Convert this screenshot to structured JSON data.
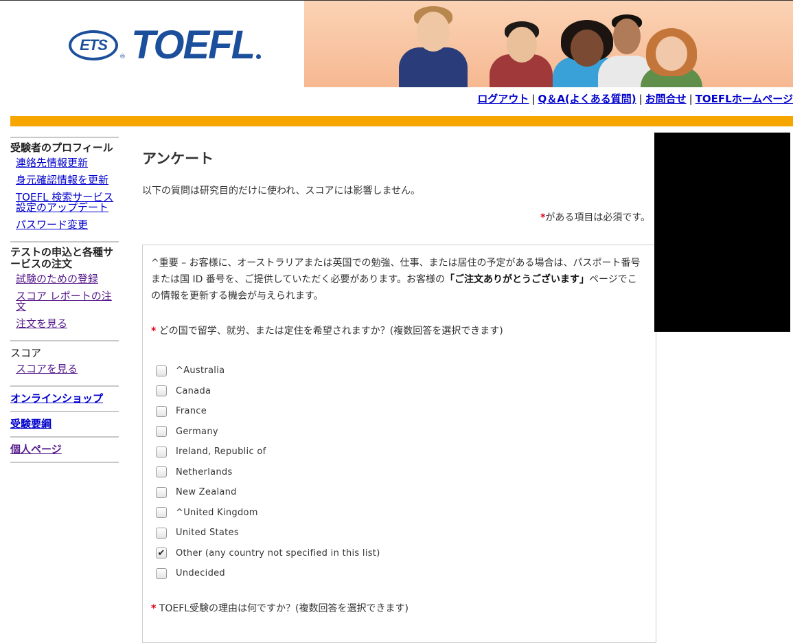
{
  "header": {
    "logo_ets": "ETS",
    "logo_reg": "®",
    "logo_toefl": "TOEFL",
    "links": [
      "ログアウト",
      "Q＆A(よくある質問)",
      "お問合せ",
      "TOEFLホームページ"
    ]
  },
  "sidebar": {
    "groups": [
      {
        "heading": "受験者のプロフィール",
        "items": [
          "連絡先情報更新",
          "身元確認情報を更新",
          "TOEFL 検索サービス設定のアップデート",
          "パスワード変更"
        ]
      },
      {
        "heading": "テストの申込と各種サービスの注文",
        "items": [
          "試験のための登録",
          "スコア レポートの注文",
          "注文を見る"
        ]
      },
      {
        "heading": "スコア",
        "items": [
          "スコアを見る"
        ]
      }
    ],
    "solo_links": [
      "オンラインショップ",
      "受験要綱",
      "個人ページ"
    ]
  },
  "main": {
    "title": "アンケート",
    "intro": "以下の質問は研究目的だけに使われ、スコアには影響しません。",
    "required_star": "*",
    "required_note": "がある項目は必須です。",
    "notice_pre": "^重要 – お客様に、オーストラリアまたは英国での勉強、仕事、または居住の予定がある場合は、パスポート番号または国 ID 番号を、ご提供していただく必要があります。お客様の",
    "notice_bold": "「ご注文ありがとうございます」",
    "notice_post": "ページでこの情報を更新する機会が与えられます。",
    "question1": "どの国で留学、就労、または定住を希望されますか？(複数回答を選択できます)",
    "options": [
      {
        "label": "^Australia",
        "checked": false
      },
      {
        "label": "Canada",
        "checked": false
      },
      {
        "label": "France",
        "checked": false
      },
      {
        "label": "Germany",
        "checked": false
      },
      {
        "label": "Ireland, Republic of",
        "checked": false
      },
      {
        "label": "Netherlands",
        "checked": false
      },
      {
        "label": "New Zealand",
        "checked": false
      },
      {
        "label": "^United Kingdom",
        "checked": false
      },
      {
        "label": "United States",
        "checked": false
      },
      {
        "label": "Other (any country not specified in this list)",
        "checked": true
      },
      {
        "label": "Undecided",
        "checked": false
      }
    ],
    "question2": "TOEFL受験の理由は何ですか？(複数回答を選択できます)"
  },
  "colors": {
    "accent_orange": "#f7a600",
    "brand_blue": "#1b4f9c",
    "link": "#0000cc",
    "required": "#e0001a"
  }
}
